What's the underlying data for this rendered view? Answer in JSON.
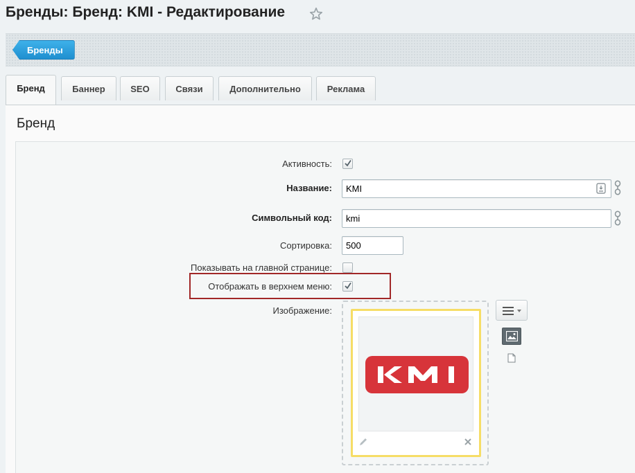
{
  "header": {
    "title": "Бренды: Бренд: KMI - Редактирование"
  },
  "nav": {
    "back_label": "Бренды"
  },
  "tabs": [
    {
      "label": "Бренд",
      "active": true
    },
    {
      "label": "Баннер"
    },
    {
      "label": "SEO"
    },
    {
      "label": "Связи"
    },
    {
      "label": "Дополнительно"
    },
    {
      "label": "Реклама"
    }
  ],
  "section": {
    "title": "Бренд"
  },
  "form": {
    "active": {
      "label": "Активность:",
      "checked": true
    },
    "name": {
      "label": "Название:",
      "value": "KMI"
    },
    "code": {
      "label": "Символьный код:",
      "value": "kmi"
    },
    "sort": {
      "label": "Сортировка:",
      "value": "500"
    },
    "show_home": {
      "label": "Показывать на главной странице:",
      "checked": false
    },
    "top_menu": {
      "label": "Отображать в верхнем меню:",
      "checked": true
    },
    "image": {
      "label": "Изображение:",
      "logo_text": "KMI"
    }
  },
  "colors": {
    "accent_blue": "#2a9fdf",
    "highlight": "#a12727",
    "logo_red": "#d7343a",
    "image_border": "#f6dd66"
  },
  "icons": [
    "star-icon",
    "check-icon",
    "translit-icon",
    "link-icon",
    "menu-icon",
    "caret-down-icon",
    "image-icon",
    "file-icon",
    "pencil-icon",
    "close-icon"
  ]
}
